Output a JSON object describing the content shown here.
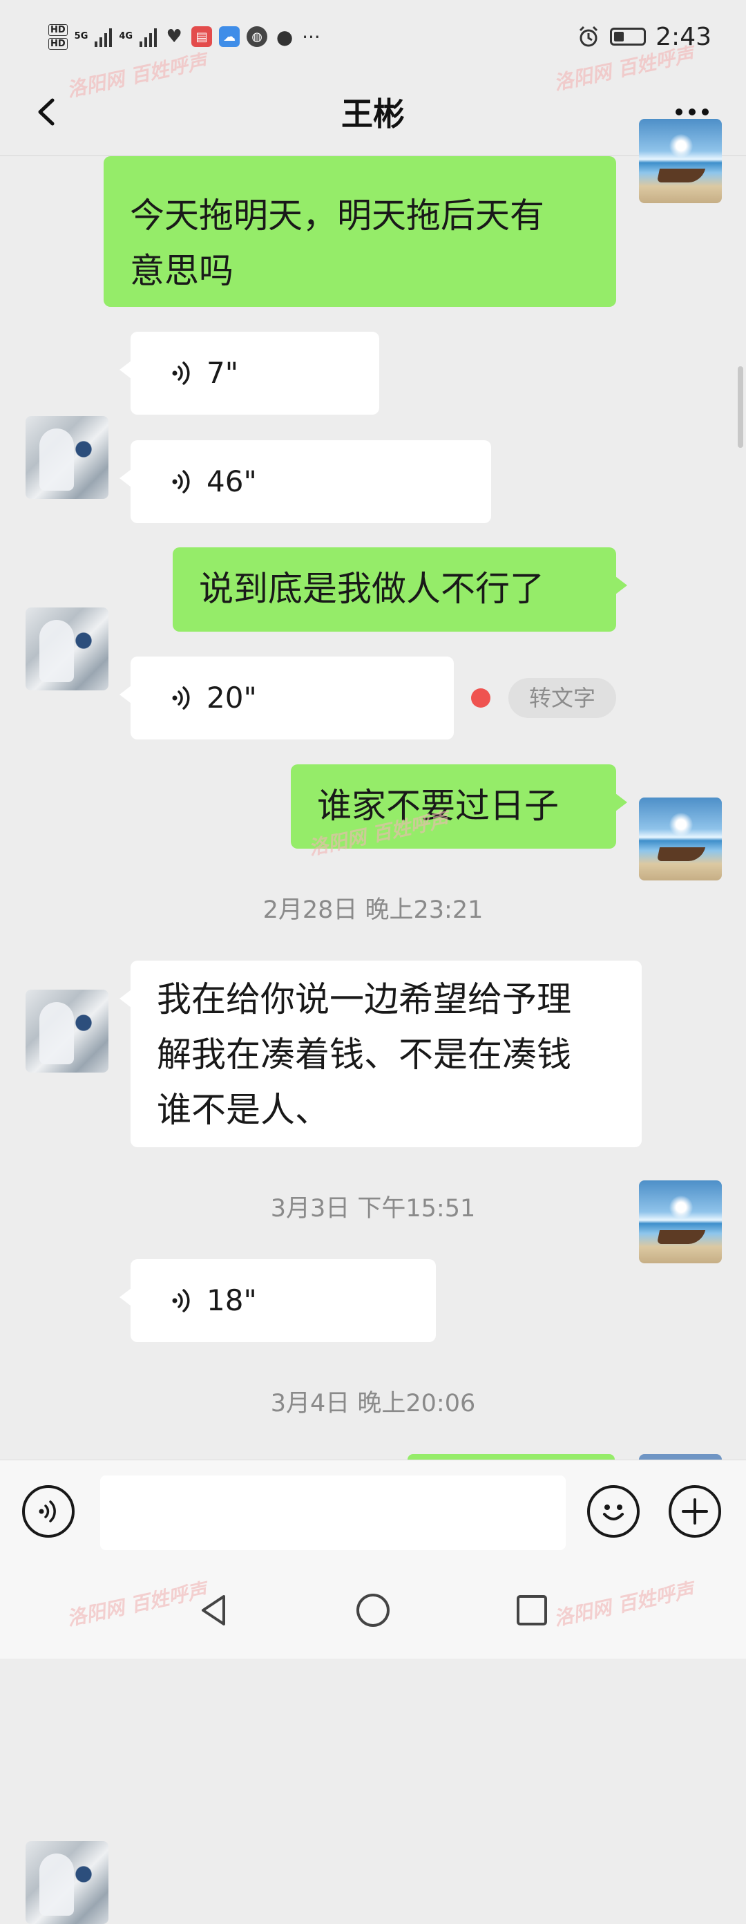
{
  "status_bar": {
    "hd1": "HD",
    "hd2": "HD",
    "net1": "5G",
    "net2": "4G",
    "more": "···",
    "time": "2:43"
  },
  "header": {
    "title": "王彬"
  },
  "messages": [
    {
      "id": "m1",
      "from": "self",
      "type": "text",
      "text_line1": "今天拖明天，明天拖后天有",
      "text_line2": "意思吗"
    },
    {
      "id": "m2",
      "from": "other",
      "type": "voice",
      "duration": "7\""
    },
    {
      "id": "m3",
      "from": "other",
      "type": "voice",
      "duration": "46\""
    },
    {
      "id": "m4",
      "from": "self",
      "type": "text",
      "text_line1": "说到底是我做人不行了"
    },
    {
      "id": "m5",
      "from": "other",
      "type": "voice",
      "duration": "20\"",
      "unread": true,
      "action": "转文字"
    },
    {
      "id": "m6",
      "from": "self",
      "type": "text",
      "text_line1": "谁家不要过日子"
    },
    {
      "id": "ts1",
      "type": "timestamp",
      "text": "2月28日 晚上23:21"
    },
    {
      "id": "m7",
      "from": "other",
      "type": "text",
      "text_line1": "我在给你说一边希望给予理",
      "text_line2": "解我在凑着钱、不是在凑钱",
      "text_line3": "谁不是人、"
    },
    {
      "id": "ts2",
      "type": "timestamp",
      "text": "3月3日 下午15:51"
    },
    {
      "id": "m8",
      "from": "other",
      "type": "voice",
      "duration": "18\""
    },
    {
      "id": "ts3",
      "type": "timestamp",
      "text": "3月4日 晚上20:06"
    }
  ],
  "input_bar": {
    "placeholder": "",
    "voice_icon": "voice-mode-icon",
    "emoji_icon": "emoji-icon",
    "plus_icon": "plus-icon"
  },
  "watermark": "洛阳网 百姓呼声",
  "colors": {
    "background": "#ededed",
    "self_bubble": "#95ec69",
    "other_bubble": "#ffffff",
    "unread_dot": "#ef5350"
  }
}
